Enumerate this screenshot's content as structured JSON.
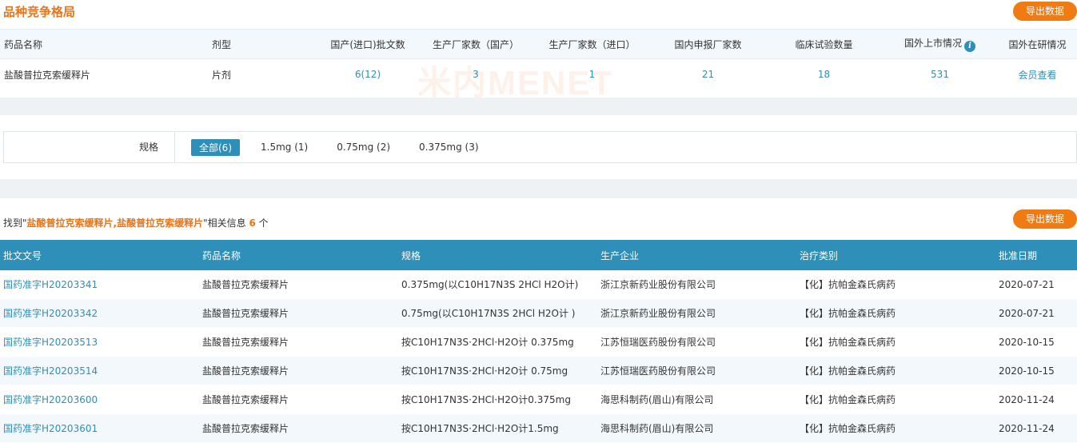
{
  "section": {
    "title": "品种竞争格局",
    "export_label": "导出数据"
  },
  "summary": {
    "headers": [
      "药品名称",
      "剂型",
      "国产(进口)批文数",
      "生产厂家数（国产）",
      "生产厂家数（进口）",
      "国内申报厂家数",
      "临床试验数量",
      "国外上市情况",
      "国外在研情况"
    ],
    "row": [
      "盐酸普拉克索缓释片",
      "片剂",
      "6(12)",
      "3",
      "1",
      "21",
      "18",
      "531",
      "会员查看"
    ],
    "info_icon": "i",
    "watermark": "米内MENET"
  },
  "spec_filter": {
    "label": "规格",
    "options": [
      "全部(6)",
      "1.5mg (1)",
      "0.75mg (2)",
      "0.375mg (3)"
    ],
    "active_index": 0
  },
  "found": {
    "prefix": "找到\"",
    "query": "盐酸普拉克索缓释片,盐酸普拉克索缓释片",
    "middle": "\"相关信息",
    "count": "6",
    "suffix": "个"
  },
  "results": {
    "export_label": "导出数据",
    "headers": [
      "批文文号",
      "药品名称",
      "规格",
      "生产企业",
      "治疗类别",
      "批准日期"
    ],
    "rows": [
      [
        "国药准字H20203341",
        "盐酸普拉克索缓释片",
        "0.375mg(以C10H17N3S 2HCl H2O计)",
        "浙江京新药业股份有限公司",
        "【化】抗帕金森氏病药",
        "2020-07-21"
      ],
      [
        "国药准字H20203342",
        "盐酸普拉克索缓释片",
        "0.75mg(以C10H17N3S 2HCl H2O计 )",
        "浙江京新药业股份有限公司",
        "【化】抗帕金森氏病药",
        "2020-07-21"
      ],
      [
        "国药准字H20203513",
        "盐酸普拉克索缓释片",
        "按C10H17N3S·2HCl·H2O计 0.375mg",
        "江苏恒瑞医药股份有限公司",
        "【化】抗帕金森氏病药",
        "2020-10-15"
      ],
      [
        "国药准字H20203514",
        "盐酸普拉克索缓释片",
        "按C10H17N3S·2HCl·H2O计 0.75mg",
        "江苏恒瑞医药股份有限公司",
        "【化】抗帕金森氏病药",
        "2020-10-15"
      ],
      [
        "国药准字H20203600",
        "盐酸普拉克索缓释片",
        "按C10H17N3S·2HCl·H2O计0.375mg",
        "海思科制药(眉山)有限公司",
        "【化】抗帕金森氏病药",
        "2020-11-24"
      ],
      [
        "国药准字H20203601",
        "盐酸普拉克索缓释片",
        "按C10H17N3S·2HCl·H2O计1.5mg",
        "海思科制药(眉山)有限公司",
        "【化】抗帕金森氏病药",
        "2020-11-24"
      ]
    ]
  },
  "colors": {
    "accent": "#f07b12",
    "primary": "#2e8fb8"
  }
}
